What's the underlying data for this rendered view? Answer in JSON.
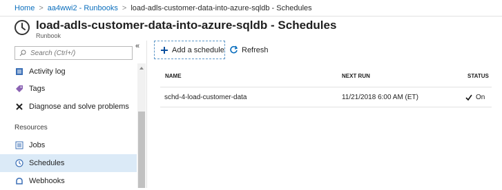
{
  "breadcrumb": {
    "items": [
      "Home",
      "aa4wwi2 - Runbooks",
      "load-adls-customer-data-into-azure-sqldb - Schedules"
    ]
  },
  "header": {
    "icon": "clock-icon",
    "title": "load-adls-customer-data-into-azure-sqldb - Schedules",
    "subtitle": "Runbook"
  },
  "sidebar": {
    "search_placeholder": "Search (Ctrl+/)",
    "collapse_label": "«",
    "items_top": [
      {
        "label": "Activity log",
        "icon": "activity-log-icon"
      },
      {
        "label": "Tags",
        "icon": "tag-icon"
      },
      {
        "label": "Diagnose and solve problems",
        "icon": "wrench-icon"
      }
    ],
    "section_label": "Resources",
    "items_resources": [
      {
        "label": "Jobs",
        "icon": "jobs-icon"
      },
      {
        "label": "Schedules",
        "icon": "clock-icon",
        "active": true
      },
      {
        "label": "Webhooks",
        "icon": "webhook-icon"
      }
    ]
  },
  "toolbar": {
    "add_label": "Add a schedule",
    "refresh_label": "Refresh"
  },
  "table": {
    "columns": [
      "NAME",
      "NEXT RUN",
      "STATUS"
    ],
    "rows": [
      {
        "name": "schd-4-load-customer-data",
        "next_run": "11/21/2018 6:00 AM (ET)",
        "status": "On"
      }
    ]
  },
  "colors": {
    "accent": "#0a6ebd",
    "active_bg": "#dbeaf7"
  }
}
